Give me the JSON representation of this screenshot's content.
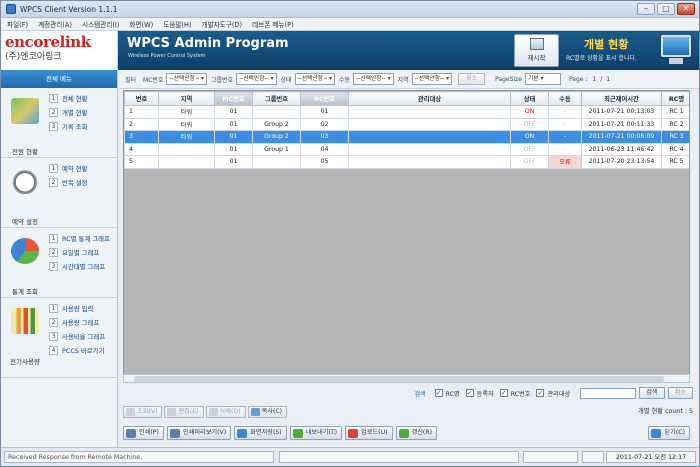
{
  "window": {
    "title": "WPCS Client Version 1.1.1"
  },
  "menu": [
    "파일(F)",
    "계정관리(A)",
    "시스템관리(I)",
    "화면(W)",
    "도움말(H)",
    "개발자도구(D)",
    "데브폰 메뉴(P)"
  ],
  "logo": {
    "brand": "encorelink",
    "sub": "(주)엔코아링크"
  },
  "banner": {
    "title": "WPCS Admin Program",
    "subtitle": "Wireless Power Control System",
    "refresh_label": "재시작",
    "page_heading": "개별 현황",
    "page_desc": "RC별로 상황을 표시 합니다."
  },
  "sidebar": {
    "header": "전체 메뉴",
    "groups": [
      {
        "label": "전원 현황",
        "icon": "map-icon",
        "items": [
          "전체 현황",
          "개별 현황",
          "기록 조회"
        ]
      },
      {
        "label": "예약 설정",
        "icon": "stopwatch-icon",
        "items": [
          "예약 현황",
          "반복 설정"
        ]
      },
      {
        "label": "통계 조회",
        "icon": "pie-chart-icon",
        "items": [
          "RC별 통계 그래프",
          "요일별 그래프",
          "시간대별 그래프"
        ]
      },
      {
        "label": "전기사용량",
        "icon": "bar-chart-icon",
        "items": [
          "사용량 입력",
          "사용량 그래프",
          "사용비율 그래프",
          "PCCS 바로가기"
        ]
      }
    ]
  },
  "filters": {
    "filter_label": "필터",
    "mc_label": "MC번호",
    "mc_value": "--선택안함--",
    "group_label": "그룹번호",
    "group_value": "--선택안함--",
    "state_label": "상태",
    "state_value": "--선택안함--",
    "manual_label": "수동",
    "manual_value": "--선택안함--",
    "region_label": "지역",
    "region_value": "--선택안함--",
    "cancel_label": "취소",
    "pagesize_label": "PageSize",
    "pagesize_value": "기본",
    "page_label": "Page :",
    "page_value": "1",
    "page_sep": "/",
    "page_total": "1"
  },
  "table": {
    "columns": [
      "번호",
      "지역",
      "MC번호",
      "그룹번호",
      "RC번호",
      "관리대상",
      "상태",
      "수동",
      "최근제어시간",
      "RC명"
    ],
    "rows": [
      {
        "no": "1",
        "region": "타워",
        "mc": "01",
        "group": "",
        "rc": "01",
        "target": "",
        "state": "ON",
        "manual": "-",
        "time": "2011-07-21 00:13:03",
        "rcname": "RC 1"
      },
      {
        "no": "2",
        "region": "타워",
        "mc": "01",
        "group": "Group 2",
        "rc": "02",
        "target": "",
        "state": "OFF",
        "manual": "-",
        "time": "2011-07-21 00:11:33",
        "rcname": "RC 2"
      },
      {
        "no": "3",
        "region": "타워",
        "mc": "01",
        "group": "Group 2",
        "rc": "03",
        "target": "",
        "state": "ON",
        "manual": "-",
        "time": "2011-07-21 00:06:09",
        "rcname": "RC 3"
      },
      {
        "no": "4",
        "region": "",
        "mc": "01",
        "group": "Group 1",
        "rc": "04",
        "target": "",
        "state": "OFF",
        "manual": "-",
        "time": "2011-06-23 11:46:42",
        "rcname": "RC 4"
      },
      {
        "no": "5",
        "region": "",
        "mc": "01",
        "group": "",
        "rc": "05",
        "target": "",
        "state": "OFF",
        "manual": "오류",
        "time": "2011-07-20 23:13:54",
        "rcname": "RC 5"
      }
    ]
  },
  "search": {
    "label": "검색",
    "options": [
      "RC명",
      "등록자",
      "RC번호",
      "관리대상"
    ],
    "search_btn": "검색",
    "cancel_btn": "취소"
  },
  "edit": {
    "view": "조회(V)",
    "edit": "편집(E)",
    "delete": "삭제(D)",
    "copy": "복사(C)",
    "count_label": "개별 현황 count : 5"
  },
  "bottom": {
    "print": "인쇄(P)",
    "preview": "인쇄미리보기(V)",
    "save": "화면저장(S)",
    "export": "내보내기(T)",
    "upload": "업로드(U)",
    "refresh": "갱신(R)",
    "close": "닫기(C)"
  },
  "status": {
    "message": "Received Response from Remote Machine.",
    "datetime": "2011-07-21 오전 12:17"
  }
}
